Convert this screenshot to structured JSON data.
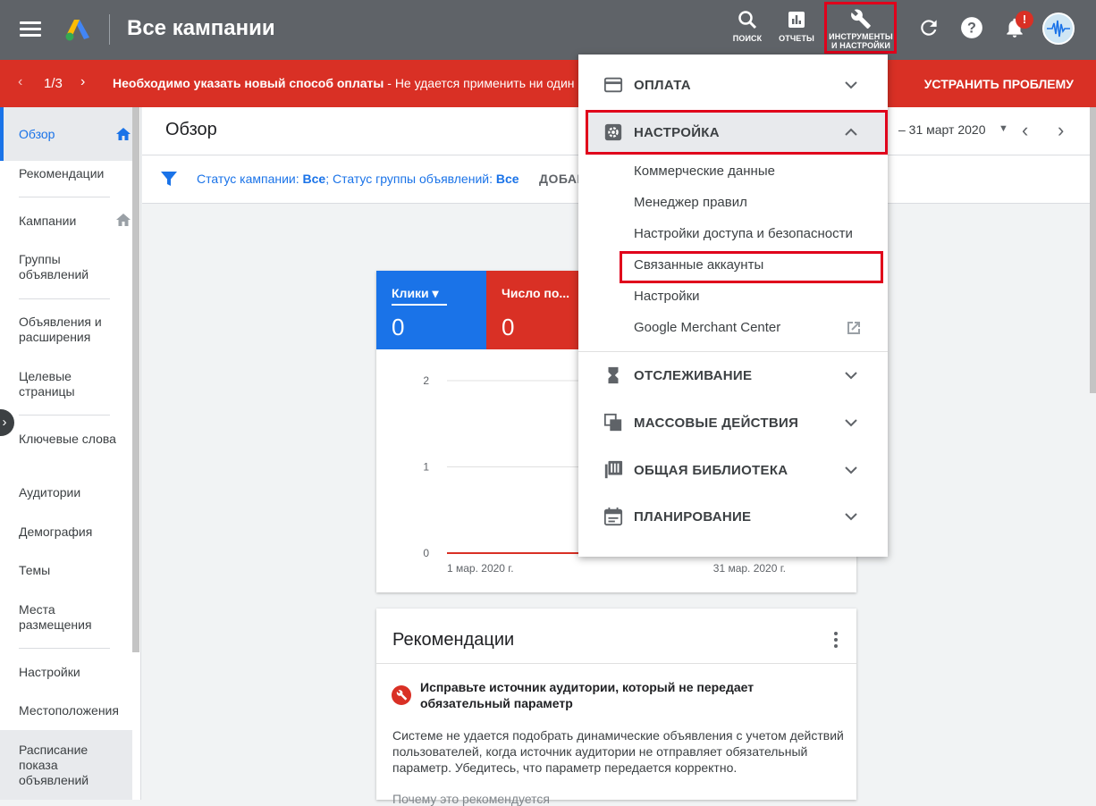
{
  "header": {
    "title": "Все кампании",
    "tools": [
      {
        "label": "ПОИСК",
        "icon": "search-icon"
      },
      {
        "label": "ОТЧЕТЫ",
        "icon": "reports-icon"
      },
      {
        "label_line1": "ИНСТРУМЕНТЫ",
        "label_line2": "И НАСТРОЙКИ",
        "icon": "wrench-icon"
      }
    ],
    "notification_badge": "!"
  },
  "alert": {
    "pager": "1/3",
    "message_bold": "Необходимо указать новый способ оплаты",
    "message_rest": " - Не удается применить ни один и",
    "fix_label": "УСТРАНИТЬ ПРОБЛЕМУ",
    "color": "#d93025"
  },
  "sidebar": {
    "items": [
      {
        "label": "Обзор",
        "active": true
      },
      {
        "label": "Рекомендации"
      },
      {
        "label": "Кампании"
      },
      {
        "label": "Группы объявлений"
      },
      {
        "label": "Объявления и расширения"
      },
      {
        "label": "Целевые страницы"
      },
      {
        "label": "Ключевые слова"
      },
      {
        "label": "Аудитории"
      },
      {
        "label": "Демография"
      },
      {
        "label": "Темы"
      },
      {
        "label": "Места размещения"
      },
      {
        "label": "Настройки"
      },
      {
        "label": "Местоположения"
      },
      {
        "label": "Расписание показа объявлений"
      }
    ]
  },
  "main": {
    "title": "Обзор",
    "date_range": "– 31 март 2020",
    "filter": {
      "part1": "Статус кампании: ",
      "part1_value": "Все",
      "part2": "; Статус группы объявлений: ",
      "part2_value": "Все",
      "add_label": "ДОБАВ"
    }
  },
  "chart_data": {
    "type": "line",
    "metrics": [
      {
        "label": "Клики",
        "value": "0",
        "color": "#1a73e8"
      },
      {
        "label": "Число по...",
        "value": "0",
        "color": "#d93025"
      }
    ],
    "x": [
      "1 мар. 2020 г.",
      "31 мар. 2020 г."
    ],
    "y_ticks": [
      0,
      1,
      2
    ],
    "ylim": [
      0,
      2
    ],
    "series": [
      {
        "color": "#d93025",
        "values": [
          0,
          0
        ]
      }
    ]
  },
  "recommendations": {
    "title": "Рекомендации",
    "item_title": "Исправьте источник аудитории, который не передает обязательный параметр",
    "item_body": "Системе не удается подобрать динамические объявления с учетом действий пользователей, когда источник аудитории не отправляет обязательный параметр. Убедитесь, что параметр передается корректно.",
    "why": "Почему это рекомендуется"
  },
  "dropdown": {
    "sections": [
      {
        "label": "ОПЛАТА",
        "icon": "credit-card-icon",
        "expanded": false
      },
      {
        "label": "НАСТРОЙКА",
        "icon": "gear-icon",
        "expanded": true
      },
      {
        "label": "ОТСЛЕЖИВАНИЕ",
        "icon": "hourglass-icon",
        "expanded": false
      },
      {
        "label": "МАССОВЫЕ ДЕЙСТВИЯ",
        "icon": "copy-icon",
        "expanded": false
      },
      {
        "label": "ОБЩАЯ БИБЛИОТЕКА",
        "icon": "library-icon",
        "expanded": false
      },
      {
        "label": "ПЛАНИРОВАНИЕ",
        "icon": "calendar-icon",
        "expanded": false
      }
    ],
    "setup_items": [
      "Коммерческие данные",
      "Менеджер правил",
      "Настройки доступа и безопасности",
      "Связанные аккаунты",
      "Настройки",
      "Google Merchant Center"
    ]
  }
}
